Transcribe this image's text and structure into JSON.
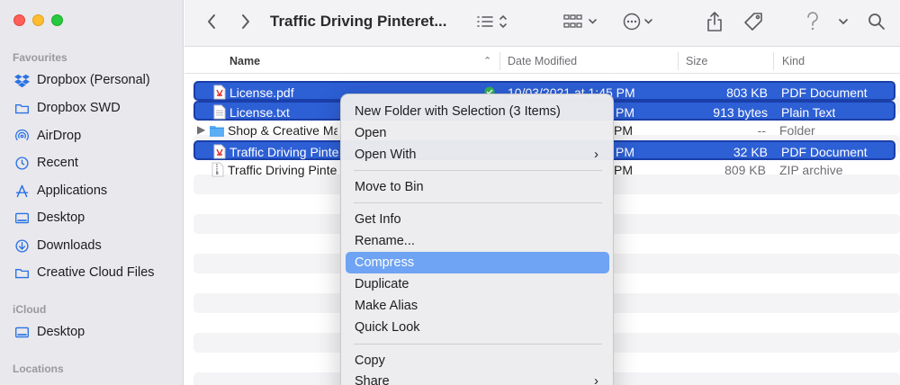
{
  "window": {
    "title": "Traffic Driving Pinteret..."
  },
  "sidebar": {
    "favourites_label": "Favourites",
    "favourites": [
      {
        "label": "Dropbox (Personal)",
        "icon": "dropbox-icon"
      },
      {
        "label": "Dropbox SWD",
        "icon": "folder-icon"
      },
      {
        "label": "AirDrop",
        "icon": "airdrop-icon"
      },
      {
        "label": "Recent",
        "icon": "clock-icon"
      },
      {
        "label": "Applications",
        "icon": "applications-icon"
      },
      {
        "label": "Desktop",
        "icon": "desktop-icon"
      },
      {
        "label": "Downloads",
        "icon": "download-icon"
      },
      {
        "label": "Creative Cloud Files",
        "icon": "folder-icon"
      }
    ],
    "icloud_label": "iCloud",
    "icloud": [
      {
        "label": "Desktop",
        "icon": "desktop-icon"
      }
    ],
    "locations_label": "Locations"
  },
  "columns": {
    "name": "Name",
    "date": "Date Modified",
    "size": "Size",
    "kind": "Kind"
  },
  "files": [
    {
      "name": "License.pdf",
      "date": "10/03/2021 at 1:45 PM",
      "size": "803 KB",
      "kind": "PDF Document",
      "selected": true,
      "icon": "pdf-icon"
    },
    {
      "name": "License.txt",
      "date": "PM",
      "size": "913 bytes",
      "kind": "Plain Text",
      "selected": true,
      "icon": "text-file-icon"
    },
    {
      "name": "Shop & Creative Ma",
      "date": "PM",
      "size": "--",
      "kind": "Folder",
      "selected": false,
      "icon": "folder-icon"
    },
    {
      "name": "Traffic Driving Pinte",
      "date": "PM",
      "size": "32 KB",
      "kind": "PDF Document",
      "selected": true,
      "icon": "pdf-icon"
    },
    {
      "name": "Traffic Driving Pinte",
      "date": "PM",
      "size": "809 KB",
      "kind": "ZIP archive",
      "selected": false,
      "icon": "zip-icon"
    }
  ],
  "context_menu": {
    "items": [
      {
        "label": "New Folder with Selection (3 Items)"
      },
      {
        "label": "Open"
      },
      {
        "label": "Open With",
        "submenu": true
      },
      {
        "label": "Move to Bin"
      },
      {
        "label": "Get Info"
      },
      {
        "label": "Rename..."
      },
      {
        "label": "Compress",
        "highlighted": true
      },
      {
        "label": "Duplicate"
      },
      {
        "label": "Make Alias"
      },
      {
        "label": "Quick Look"
      },
      {
        "label": "Copy"
      },
      {
        "label": "Share",
        "submenu": true
      }
    ]
  },
  "colors": {
    "selection": "#2d5fd5",
    "menu_highlight": "#6fa3f3",
    "sidebar_accent": "#2a72e5"
  }
}
